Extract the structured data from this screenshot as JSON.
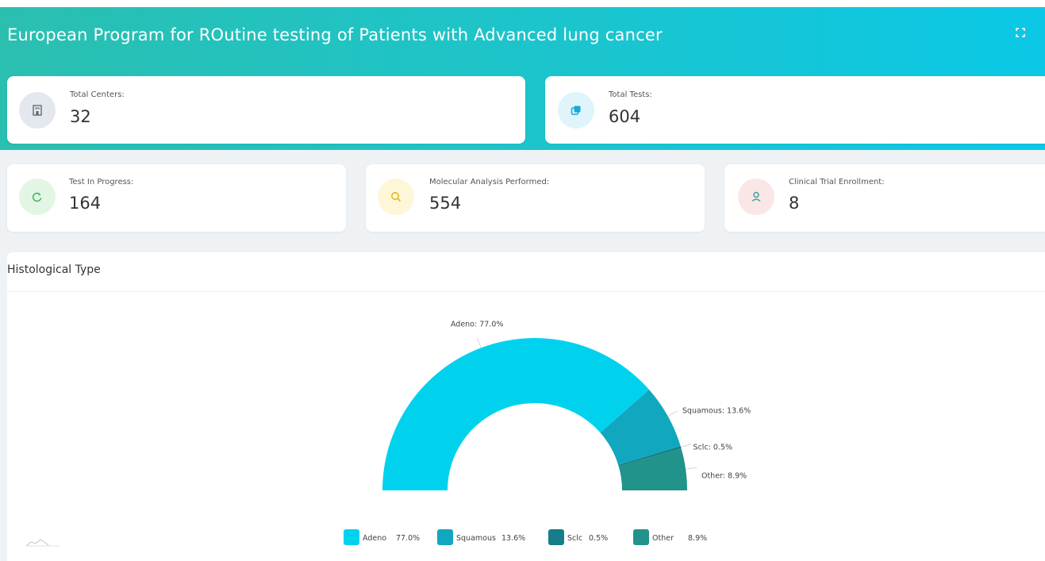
{
  "header": {
    "title": "European Program for ROutine testing of Patients with Advanced lung cancer",
    "expand_icon": "fullscreen-icon"
  },
  "stats": {
    "total_centers": {
      "label": "Total Centers:",
      "value": "32",
      "icon": "building-icon",
      "icon_bg": "#e4e8ee",
      "icon_color": "#5a6270"
    },
    "total_tests": {
      "label": "Total Tests:",
      "value": "604",
      "icon": "copy-icon",
      "icon_bg": "#dff4fb",
      "icon_color": "#17a9d6"
    },
    "tests_in_progress": {
      "label": "Test In Progress:",
      "value": "164",
      "icon": "refresh-icon",
      "icon_bg": "#e3f6e6",
      "icon_color": "#3fb35a"
    },
    "molecular_analysis": {
      "label": "Molecular Analysis Performed:",
      "value": "554",
      "icon": "search-icon",
      "icon_bg": "#fdf6d8",
      "icon_color": "#e8b416"
    },
    "clinical_trial": {
      "label": "Clinical Trial Enrollment:",
      "value": "8",
      "icon": "user-icon",
      "icon_bg": "#fbe6e6",
      "icon_color": "#3aa69b"
    }
  },
  "histology_panel": {
    "title": "Histological Type"
  },
  "chart_data": {
    "type": "pie",
    "variant": "half-donut",
    "title": "Histological Type",
    "categories": [
      "Adeno",
      "Squamous",
      "Sclc",
      "Other"
    ],
    "values": [
      77.0,
      13.6,
      0.5,
      8.9
    ],
    "slice_labels": [
      "Adeno: 77.0%",
      "Squamous: 13.6%",
      "Sclc: 0.5%",
      "Other: 8.9%"
    ],
    "legend_values": [
      "77.0%",
      "13.6%",
      "0.5%",
      "8.9%"
    ],
    "colors": [
      "#00d2ee",
      "#11a8bf",
      "#147e8a",
      "#21938a"
    ],
    "legend": "bottom"
  }
}
